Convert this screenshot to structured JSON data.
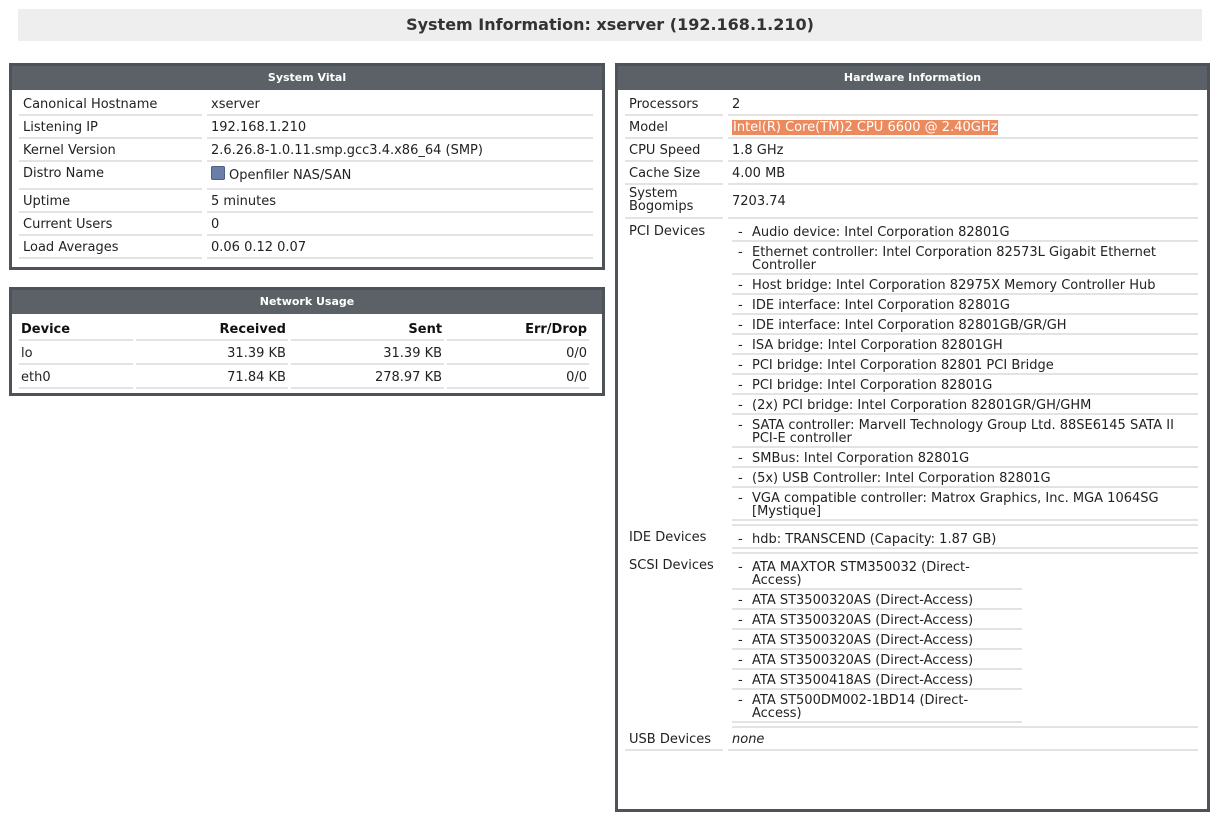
{
  "page_title": "System Information: xserver (192.168.1.210)",
  "system_vital": {
    "heading": "System Vital",
    "rows": [
      {
        "label": "Canonical Hostname",
        "value": "xserver"
      },
      {
        "label": "Listening IP",
        "value": "192.168.1.210"
      },
      {
        "label": "Kernel Version",
        "value": "2.6.26.8-1.0.11.smp.gcc3.4.x86_64 (SMP)"
      },
      {
        "label": "Distro Name",
        "value": "Openfiler NAS/SAN",
        "icon": "distro-logo-icon"
      },
      {
        "label": "Uptime",
        "value": "5 minutes"
      },
      {
        "label": "Current Users",
        "value": "0"
      },
      {
        "label": "Load Averages",
        "value": "0.06 0.12 0.07"
      }
    ]
  },
  "network_usage": {
    "heading": "Network Usage",
    "columns": [
      "Device",
      "Received",
      "Sent",
      "Err/Drop"
    ],
    "rows": [
      [
        "lo",
        "31.39 KB",
        "31.39 KB",
        "0/0"
      ],
      [
        "eth0",
        "71.84 KB",
        "278.97 KB",
        "0/0"
      ]
    ]
  },
  "hardware": {
    "heading": "Hardware Information",
    "processors_label": "Processors",
    "processors": "2",
    "model_label": "Model",
    "model": "Intel(R) Core(TM)2 CPU 6600 @ 2.40GHz",
    "cpu_speed_label": "CPU Speed",
    "cpu_speed": "1.8 GHz",
    "cache_size_label": "Cache Size",
    "cache_size": "4.00 MB",
    "bogomips_label": "System Bogomips",
    "bogomips": "7203.74",
    "pci_label": "PCI Devices",
    "pci_devices": [
      "Audio device: Intel Corporation 82801G",
      "Ethernet controller: Intel Corporation 82573L Gigabit Ethernet Controller",
      "Host bridge: Intel Corporation 82975X Memory Controller Hub",
      "IDE interface: Intel Corporation 82801G",
      "IDE interface: Intel Corporation 82801GB/GR/GH",
      "ISA bridge: Intel Corporation 82801GH",
      "PCI bridge: Intel Corporation 82801 PCI Bridge",
      "PCI bridge: Intel Corporation 82801G",
      "(2x) PCI bridge: Intel Corporation 82801GR/GH/GHM",
      "SATA controller: Marvell Technology Group Ltd. 88SE6145 SATA II PCI-E controller",
      "SMBus: Intel Corporation 82801G",
      "(5x) USB Controller: Intel Corporation 82801G",
      "VGA compatible controller: Matrox Graphics, Inc. MGA 1064SG [Mystique]"
    ],
    "ide_label": "IDE Devices",
    "ide_devices": [
      "hdb: TRANSCEND (Capacity: 1.87 GB)"
    ],
    "scsi_label": "SCSI Devices",
    "scsi_devices": [
      "ATA MAXTOR STM350032 (Direct-Access)",
      "ATA ST3500320AS (Direct-Access)",
      "ATA ST3500320AS (Direct-Access)",
      "ATA ST3500320AS (Direct-Access)",
      "ATA ST3500320AS (Direct-Access)",
      "ATA ST3500418AS (Direct-Access)",
      "ATA ST500DM002-1BD14 (Direct-Access)"
    ],
    "usb_label": "USB Devices",
    "usb": "none"
  },
  "colors": {
    "box_border": "#4d5358",
    "box_header": "#5b6166",
    "title_bg": "#eeeeee",
    "highlight": "#ec8a5e",
    "row_rule": "#e3e3e3"
  }
}
